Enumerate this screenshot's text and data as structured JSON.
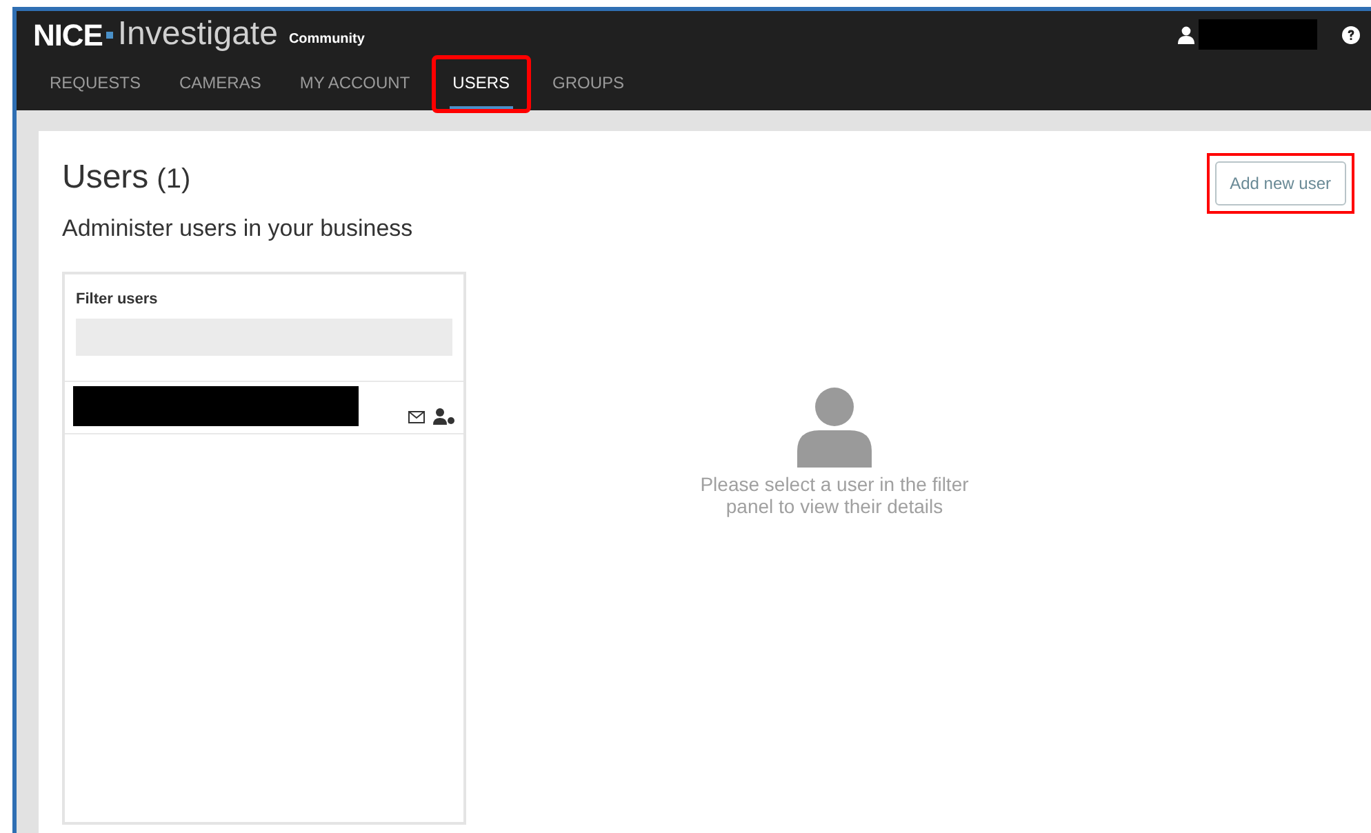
{
  "header": {
    "brand": "NICE",
    "product": "Investigate",
    "edition": "Community",
    "user": {
      "redacted": true
    }
  },
  "tabs": [
    {
      "label": "REQUESTS",
      "selected": false,
      "highlighted": false
    },
    {
      "label": "CAMERAS",
      "selected": false,
      "highlighted": false
    },
    {
      "label": "MY ACCOUNT",
      "selected": false,
      "highlighted": false
    },
    {
      "label": "USERS",
      "selected": true,
      "highlighted": true
    },
    {
      "label": "GROUPS",
      "selected": false,
      "highlighted": false
    }
  ],
  "page": {
    "title": "Users",
    "count": "(1)",
    "subtitle": "Administer users in your business"
  },
  "add_button": {
    "label": "Add new user",
    "highlighted": true
  },
  "filter": {
    "label": "Filter users"
  },
  "users": [
    {
      "redacted": true
    }
  ],
  "empty_state": {
    "message": "Please select a user in the filter panel to view their details"
  }
}
